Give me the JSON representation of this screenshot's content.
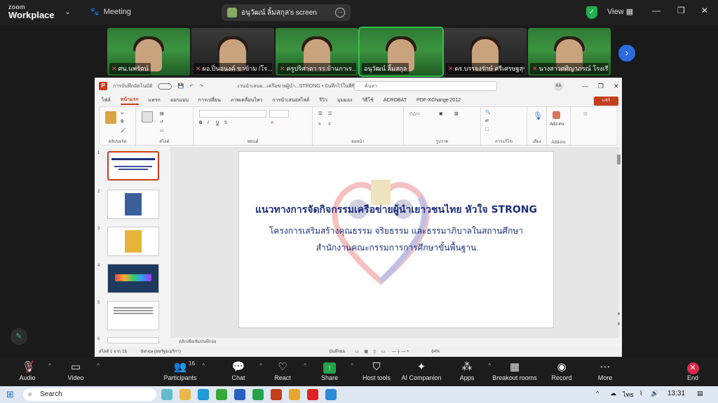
{
  "zoom": {
    "brand_top": "zoom",
    "brand_bottom": "Workplace",
    "meeting_label": "Meeting",
    "screen_title": "อนุวัฒน์ ลิ้มสกุล's screen",
    "view_label": "View",
    "participants": [
      {
        "name": "ศน.นพรัตน์"
      },
      {
        "name": "ผอ.ปิ่นอนงค์ ขาข้าม /โร..."
      },
      {
        "name": "ครูปริศาดา รร.บ้านกาเร..."
      },
      {
        "name": "อนุวัฒน์ ลิ้มสกุล"
      },
      {
        "name": "ดร.บรรจงรักษ์ ศรีเศรษฐสุขศิริ"
      },
      {
        "name": "นางสาวศศิญาภรณ์ โรงเรีย..."
      }
    ],
    "toolbar": {
      "audio": "Audio",
      "video": "Video",
      "participants": "Participants",
      "participants_count": "16",
      "chat": "Chat",
      "react": "React",
      "share": "Share",
      "host_tools": "Host tools",
      "ai": "AI Companion",
      "apps": "Apps",
      "breakout": "Breakout rooms",
      "record": "Record",
      "more": "More",
      "end": "End"
    }
  },
  "ppt": {
    "autosave": "การบันทึกอัตโนมัติ",
    "filename": "งานนำเสนอ...เครือข่ายผู้นำ...STRONG • บันทึกไว้ในพีซีนี้",
    "search_placeholder": "ค้นหา",
    "user_initials": "AA",
    "share_label": "แชร์",
    "tabs": [
      "ไฟล์",
      "หน้าแรก",
      "แทรก",
      "ออกแบบ",
      "การเปลี่ยน",
      "ภาพเคลื่อนไหว",
      "การนำเสนอสไลด์",
      "รีวิว",
      "มุมมอง",
      "วิธีใช้",
      "ACROBAT",
      "PDF-XChange 2012"
    ],
    "groups": [
      "คลิปบอร์ด",
      "สไลด์",
      "ฟอนต์",
      "ย่อหน้า",
      "รูปวาด",
      "การแก้ไข",
      "เสียง",
      "Add-ins"
    ],
    "addins_label": "Add-ins",
    "notes_placeholder": "คลิกเพื่อเพิ่มบันทึกย่อ",
    "status_slide": "สไลด์ 1 จาก 16",
    "status_lang": "อังกฤษ (สหรัฐอเมริกา)",
    "status_notes": "บันทึกย่อ",
    "zoom_level": "64%",
    "slide": {
      "title": "แนวทางการจัดกิจกรรมเครือข่ายผู้นำเยาวชนไทย หัวใจ STRONG",
      "line1": "โครงการเสริมสร้างคุณธรรม จริยธรรม และธรรมาภิบาลในสถานศึกษา",
      "line2": "สำนักงานคณะกรรมการการศึกษาขั้นพื้นฐาน"
    }
  },
  "taskbar": {
    "search": "Search",
    "lang": "ไทย",
    "time": "13:31"
  }
}
